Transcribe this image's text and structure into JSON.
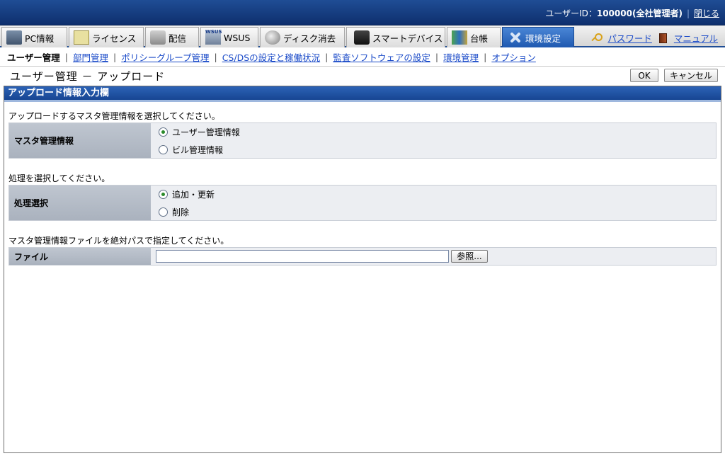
{
  "header": {
    "user_label": "ユーザーID：",
    "user_value": "100000(全社管理者)",
    "close_label": "閉じる"
  },
  "tabs": [
    {
      "label": "PC情報",
      "icon": "pc-icon"
    },
    {
      "label": "ライセンス",
      "icon": "license-icon"
    },
    {
      "label": "配信",
      "icon": "distribution-icon"
    },
    {
      "label": "WSUS",
      "icon": "wsus-icon"
    },
    {
      "label": "ディスク消去",
      "icon": "disk-erase-icon"
    },
    {
      "label": "スマートデバイス",
      "icon": "smart-device-icon"
    },
    {
      "label": "台帳",
      "icon": "ledger-icon"
    },
    {
      "label": "環境設定",
      "icon": "environment-settings-icon",
      "active": true
    }
  ],
  "header_links": {
    "password": "パスワード",
    "manual": "マニュアル"
  },
  "subnav": {
    "current": "ユーザー管理",
    "links": [
      "部門管理",
      "ポリシーグループ管理",
      "CS/DSの設定と稼働状況",
      "監査ソフトウェアの設定",
      "環境管理",
      "オプション"
    ]
  },
  "page": {
    "title": "ユーザー管理 － アップロード",
    "ok_label": "OK",
    "cancel_label": "キャンセル"
  },
  "section": {
    "title": "アップロード情報入力欄",
    "master": {
      "instruction": "アップロードするマスタ管理情報を選択してください。",
      "label": "マスタ管理情報",
      "options": [
        {
          "label": "ユーザー管理情報",
          "selected": true
        },
        {
          "label": "ビル管理情報",
          "selected": false
        }
      ]
    },
    "process": {
      "instruction": "処理を選択してください。",
      "label": "処理選択",
      "options": [
        {
          "label": "追加・更新",
          "selected": true
        },
        {
          "label": "削除",
          "selected": false
        }
      ]
    },
    "file": {
      "instruction": "マスタ管理情報ファイルを絶対パスで指定してください。",
      "label": "ファイル",
      "value": "",
      "browse_label": "参照..."
    }
  }
}
